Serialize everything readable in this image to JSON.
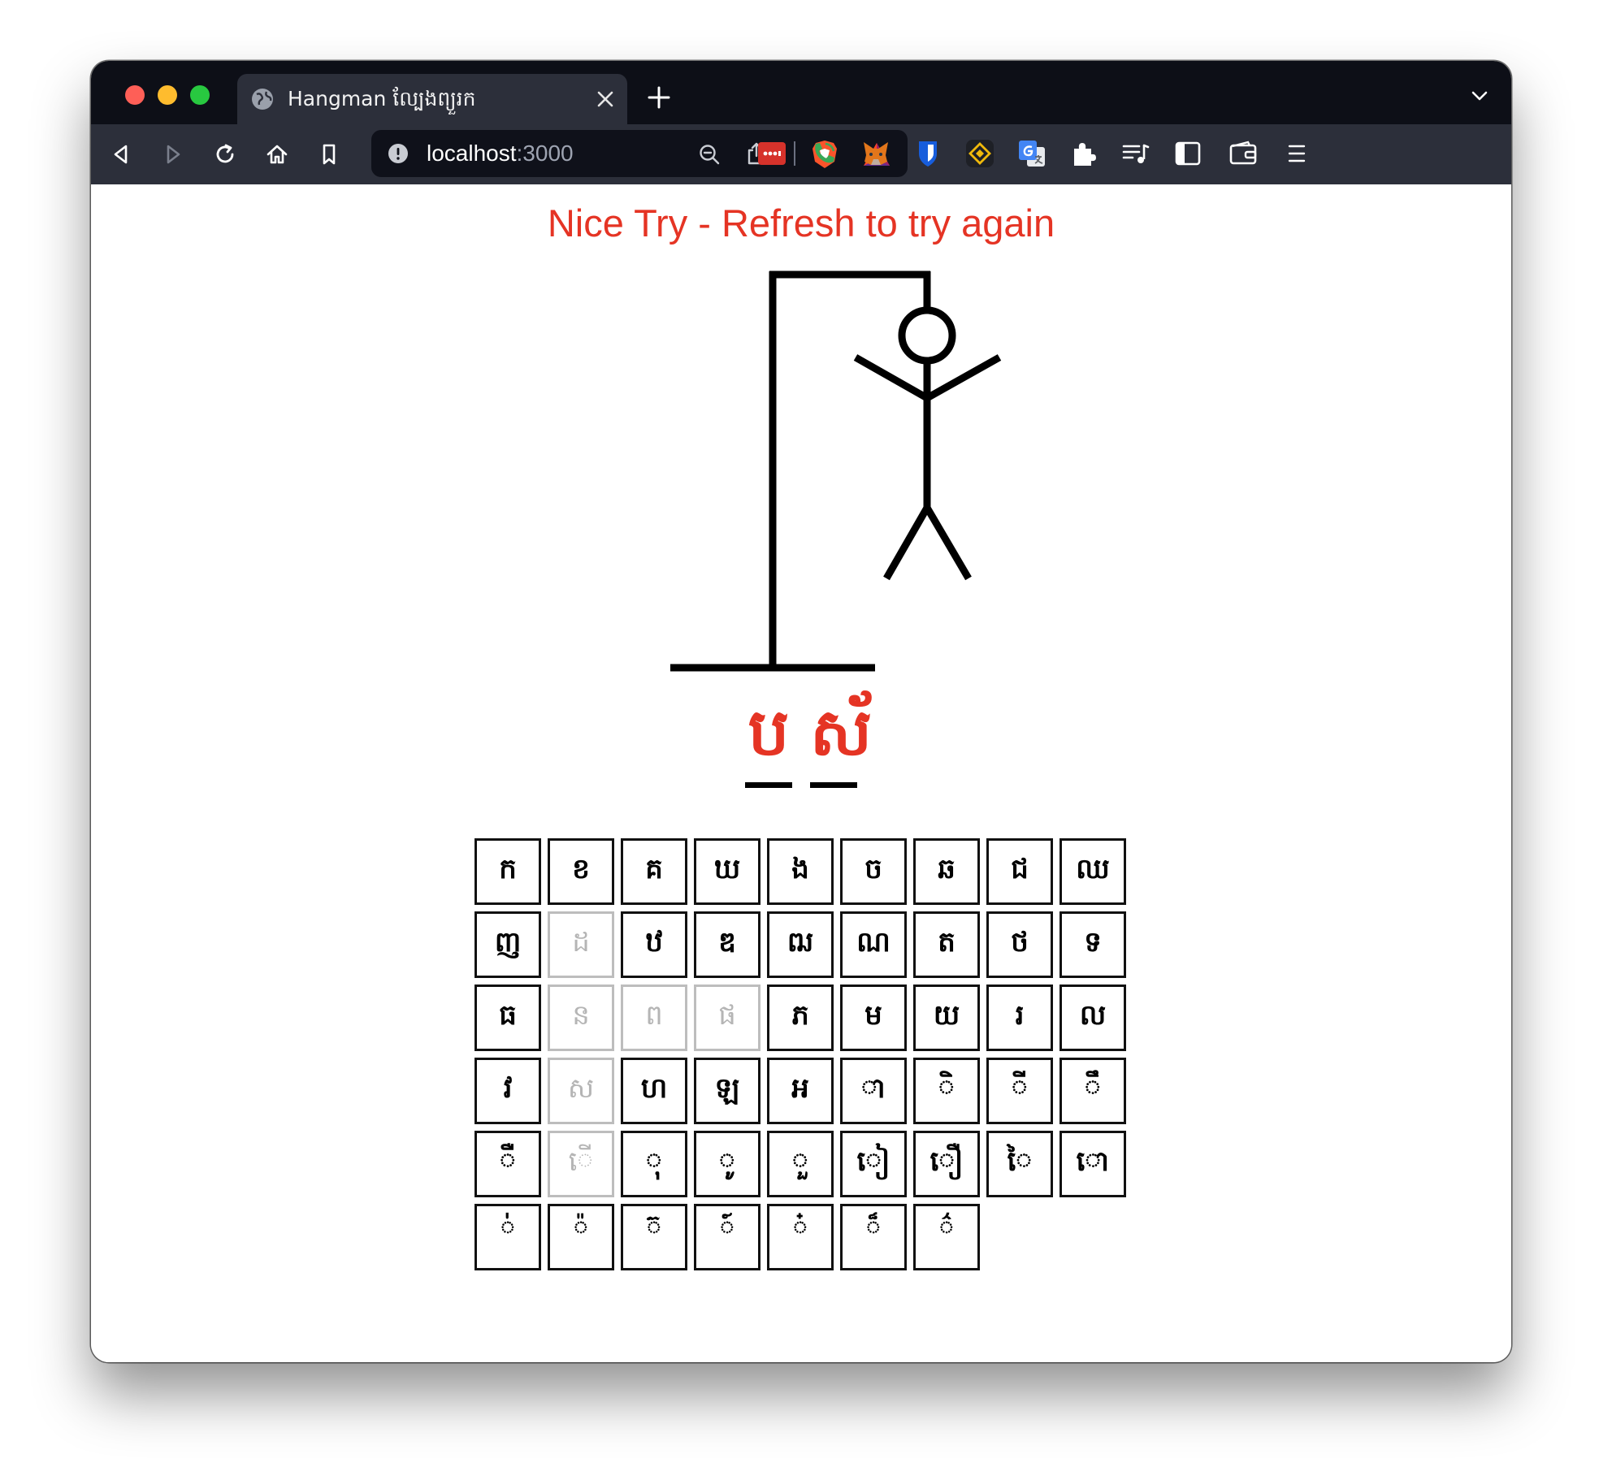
{
  "browser": {
    "tab_title": "Hangman ល្បែងព្យួរក",
    "url_host": "localhost",
    "url_port": ":3000",
    "colors": {
      "tabstrip": "#0d0f17",
      "toolbar": "#2c2f3a",
      "urlbar": "#0f111a",
      "accent_red": "#e53424"
    },
    "toolbar_icons": [
      "back-icon",
      "forward-icon",
      "reload-icon",
      "home-icon",
      "bookmark-icon"
    ],
    "url_icons": [
      "site-info-icon",
      "zoom-out-icon",
      "share-icon",
      "brave-shields-icon",
      "brave-rewards-icon"
    ],
    "extension_icons": [
      "dots-extension-icon",
      "phone-extension-icon",
      "metamask-fox-icon",
      "bitwarden-shield-icon",
      "binance-wallet-icon",
      "google-translate-icon",
      "extensions-puzzle-icon",
      "media-playlist-icon",
      "sidebar-icon",
      "wallet-icon",
      "menu-icon"
    ]
  },
  "game": {
    "status_message": "Nice Try - Refresh to try again",
    "hangman_parts_shown": [
      "head",
      "body",
      "left-arm",
      "right-arm",
      "left-leg",
      "right-leg"
    ],
    "word_letters": [
      {
        "char": "ប",
        "revealed": true
      },
      {
        "char": "ស័",
        "revealed": true
      }
    ],
    "keys": [
      {
        "char": "ក",
        "used": false
      },
      {
        "char": "ខ",
        "used": false
      },
      {
        "char": "គ",
        "used": false
      },
      {
        "char": "ឃ",
        "used": false
      },
      {
        "char": "ង",
        "used": false
      },
      {
        "char": "ច",
        "used": false
      },
      {
        "char": "ឆ",
        "used": false
      },
      {
        "char": "ជ",
        "used": false
      },
      {
        "char": "ឈ",
        "used": false
      },
      {
        "char": "ញ",
        "used": false
      },
      {
        "char": "ដ",
        "used": true
      },
      {
        "char": "ឋ",
        "used": false
      },
      {
        "char": "ឌ",
        "used": false
      },
      {
        "char": "ឍ",
        "used": false
      },
      {
        "char": "ណ",
        "used": false
      },
      {
        "char": "ត",
        "used": false
      },
      {
        "char": "ថ",
        "used": false
      },
      {
        "char": "ទ",
        "used": false
      },
      {
        "char": "ធ",
        "used": false
      },
      {
        "char": "ន",
        "used": true
      },
      {
        "char": "ព",
        "used": true
      },
      {
        "char": "ផ",
        "used": true
      },
      {
        "char": "ភ",
        "used": false
      },
      {
        "char": "ម",
        "used": false
      },
      {
        "char": "យ",
        "used": false
      },
      {
        "char": "រ",
        "used": false
      },
      {
        "char": "ល",
        "used": false
      },
      {
        "char": "វ",
        "used": false
      },
      {
        "char": "ស",
        "used": true
      },
      {
        "char": "ហ",
        "used": false
      },
      {
        "char": "ឡ",
        "used": false
      },
      {
        "char": "អ",
        "used": false
      },
      {
        "char": "ា",
        "used": false
      },
      {
        "char": "ិ",
        "used": false
      },
      {
        "char": "ី",
        "used": false
      },
      {
        "char": "ឹ",
        "used": false
      },
      {
        "char": "ឺ",
        "used": false
      },
      {
        "char": "ើ",
        "used": true
      },
      {
        "char": "ុ",
        "used": false
      },
      {
        "char": "ូ",
        "used": false
      },
      {
        "char": "ួ",
        "used": false
      },
      {
        "char": "ៀ",
        "used": false
      },
      {
        "char": "ឿ",
        "used": false
      },
      {
        "char": "ៃ",
        "used": false
      },
      {
        "char": "ោ",
        "used": false
      },
      {
        "char": "់",
        "used": false,
        "mark": true
      },
      {
        "char": "៉",
        "used": false,
        "mark": true
      },
      {
        "char": "៊",
        "used": false,
        "mark": true
      },
      {
        "char": "៍",
        "used": false,
        "mark": true
      },
      {
        "char": "៎",
        "used": false,
        "mark": true
      },
      {
        "char": "៏",
        "used": false,
        "mark": true
      },
      {
        "char": "៌",
        "used": false,
        "mark": true
      }
    ]
  }
}
